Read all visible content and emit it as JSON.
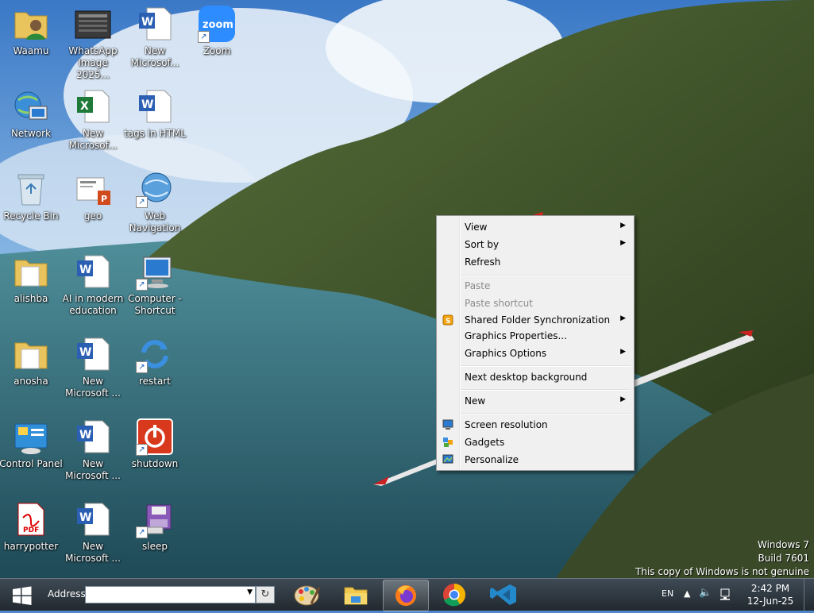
{
  "desktop_icons": [
    {
      "label": "Waamu"
    },
    {
      "label": "WhatsApp Image 2025..."
    },
    {
      "label": "New Microsof..."
    },
    {
      "label": "Zoom",
      "logo_text": "zoom"
    },
    {
      "label": "Network"
    },
    {
      "label": "New Microsof..."
    },
    {
      "label": "tags in HTML"
    },
    {
      "label": "Recycle Bin"
    },
    {
      "label": "geo"
    },
    {
      "label": "Web Navigation"
    },
    {
      "label": "alishba"
    },
    {
      "label": "AI in modern education"
    },
    {
      "label": "Computer - Shortcut"
    },
    {
      "label": "anosha"
    },
    {
      "label": "New Microsoft ..."
    },
    {
      "label": "restart"
    },
    {
      "label": "Control Panel"
    },
    {
      "label": "New Microsoft ..."
    },
    {
      "label": "shutdown"
    },
    {
      "label": "harrypotter",
      "logo_text": "PDF"
    },
    {
      "label": "New Microsoft ..."
    },
    {
      "label": "sleep"
    }
  ],
  "context_menu": {
    "items": [
      {
        "label": "View",
        "submenu": true
      },
      {
        "label": "Sort by",
        "submenu": true
      },
      {
        "label": "Refresh"
      },
      {
        "label": "Paste",
        "disabled": true
      },
      {
        "label": "Paste shortcut",
        "disabled": true
      },
      {
        "label": "Shared Folder Synchronization",
        "submenu": true,
        "icon": "shared-folder-sync-icon"
      },
      {
        "label": "Graphics Properties..."
      },
      {
        "label": "Graphics Options",
        "submenu": true
      },
      {
        "label": "Next desktop background"
      },
      {
        "label": "New",
        "submenu": true
      },
      {
        "label": "Screen resolution",
        "icon": "screen-resolution-icon"
      },
      {
        "label": "Gadgets",
        "icon": "gadgets-icon"
      },
      {
        "label": "Personalize",
        "icon": "personalize-icon"
      }
    ]
  },
  "watermark": {
    "line1": "Windows 7",
    "line2": "Build 7601",
    "line3": "This copy of Windows is not genuine"
  },
  "taskbar": {
    "address_label": "Address",
    "address_value": "",
    "apps": [
      "paint-icon",
      "file-explorer-icon",
      "firefox-icon",
      "chrome-icon",
      "vscode-icon"
    ],
    "language": "EN",
    "time": "2:42 PM",
    "date": "12-Jun-25"
  },
  "colors": {
    "highlight_arrow": "#e02020",
    "taskbar": "#2a3239",
    "menu_bg": "#f0f0f0"
  }
}
